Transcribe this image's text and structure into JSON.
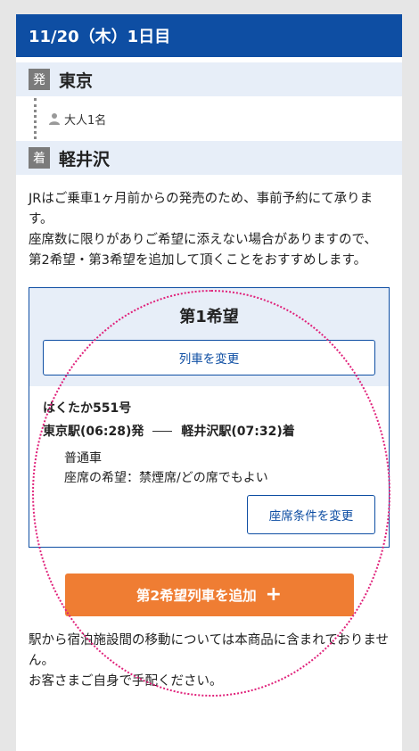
{
  "day": {
    "header": "11/20（木）1日目"
  },
  "departure": {
    "tag": "発",
    "station": "東京"
  },
  "passenger": {
    "label": "大人1名"
  },
  "arrival": {
    "tag": "着",
    "station": "軽井沢"
  },
  "notice": {
    "line1": "JRはご乗車1ヶ月前からの発売のため、事前予約にて承ります。",
    "line2": "座席数に限りがありご希望に添えない場合がありますので、第2希望・第3希望を追加して頂くことをおすすめします。"
  },
  "hope1": {
    "title": "第1希望",
    "change_train_label": "列車を変更",
    "train_name": "はくたか551号",
    "from": "東京駅(06:28)発",
    "to": "軽井沢駅(07:32)着",
    "car_class": "普通車",
    "seat_pref": "座席の希望：禁煙席/どの席でもよい",
    "change_seat_label": "座席条件を変更"
  },
  "add_button": {
    "label": "第2希望列車を追加",
    "icon": "plus-icon"
  },
  "footer": {
    "line1": "駅から宿泊施設間の移動については本商品に含まれておりません。",
    "line2": "お客さまご自身で手配ください。"
  },
  "colors": {
    "primary": "#0e4ea3",
    "accent": "#ef7d33",
    "highlight": "#e0217a"
  }
}
